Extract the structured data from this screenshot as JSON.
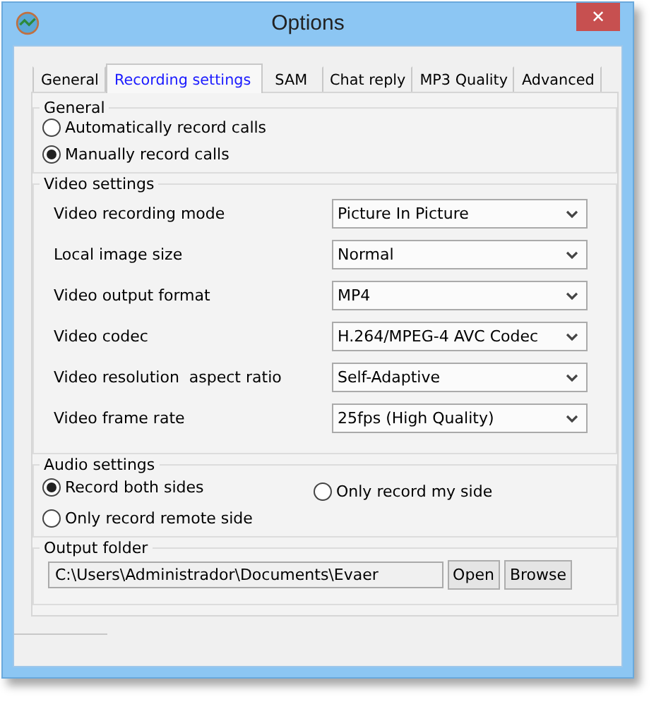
{
  "window": {
    "title": "Options",
    "close": "✕"
  },
  "tabs": [
    {
      "label": "General",
      "selected": false
    },
    {
      "label": "Recording settings",
      "selected": true
    },
    {
      "label": "SAM",
      "selected": false
    },
    {
      "label": "Chat reply",
      "selected": false
    },
    {
      "label": "MP3 Quality",
      "selected": false
    },
    {
      "label": "Advanced",
      "selected": false
    }
  ],
  "general": {
    "title": "General",
    "options": [
      {
        "label": "Automatically record calls",
        "selected": false
      },
      {
        "label": "Manually record calls",
        "selected": true
      }
    ]
  },
  "video": {
    "title": "Video settings",
    "rows": [
      {
        "label": "Video recording mode",
        "value": "Picture In Picture"
      },
      {
        "label": "Local image size",
        "value": "Normal"
      },
      {
        "label": "Video output format",
        "value": "MP4"
      },
      {
        "label": "Video codec",
        "value": "H.264/MPEG-4 AVC Codec"
      },
      {
        "label": "Video resolution  aspect ratio",
        "value": "Self-Adaptive"
      },
      {
        "label": "Video frame rate",
        "value": "25fps (High Quality)"
      }
    ]
  },
  "audio": {
    "title": "Audio settings",
    "options": [
      {
        "label": "Record both sides",
        "selected": true
      },
      {
        "label": "Only record my side",
        "selected": false
      },
      {
        "label": "Only record remote side",
        "selected": false
      }
    ]
  },
  "output": {
    "title": "Output folder",
    "path": "C:\\Users\\Administrador\\Documents\\Evaer",
    "buttons": [
      "Open",
      "Browse"
    ]
  }
}
